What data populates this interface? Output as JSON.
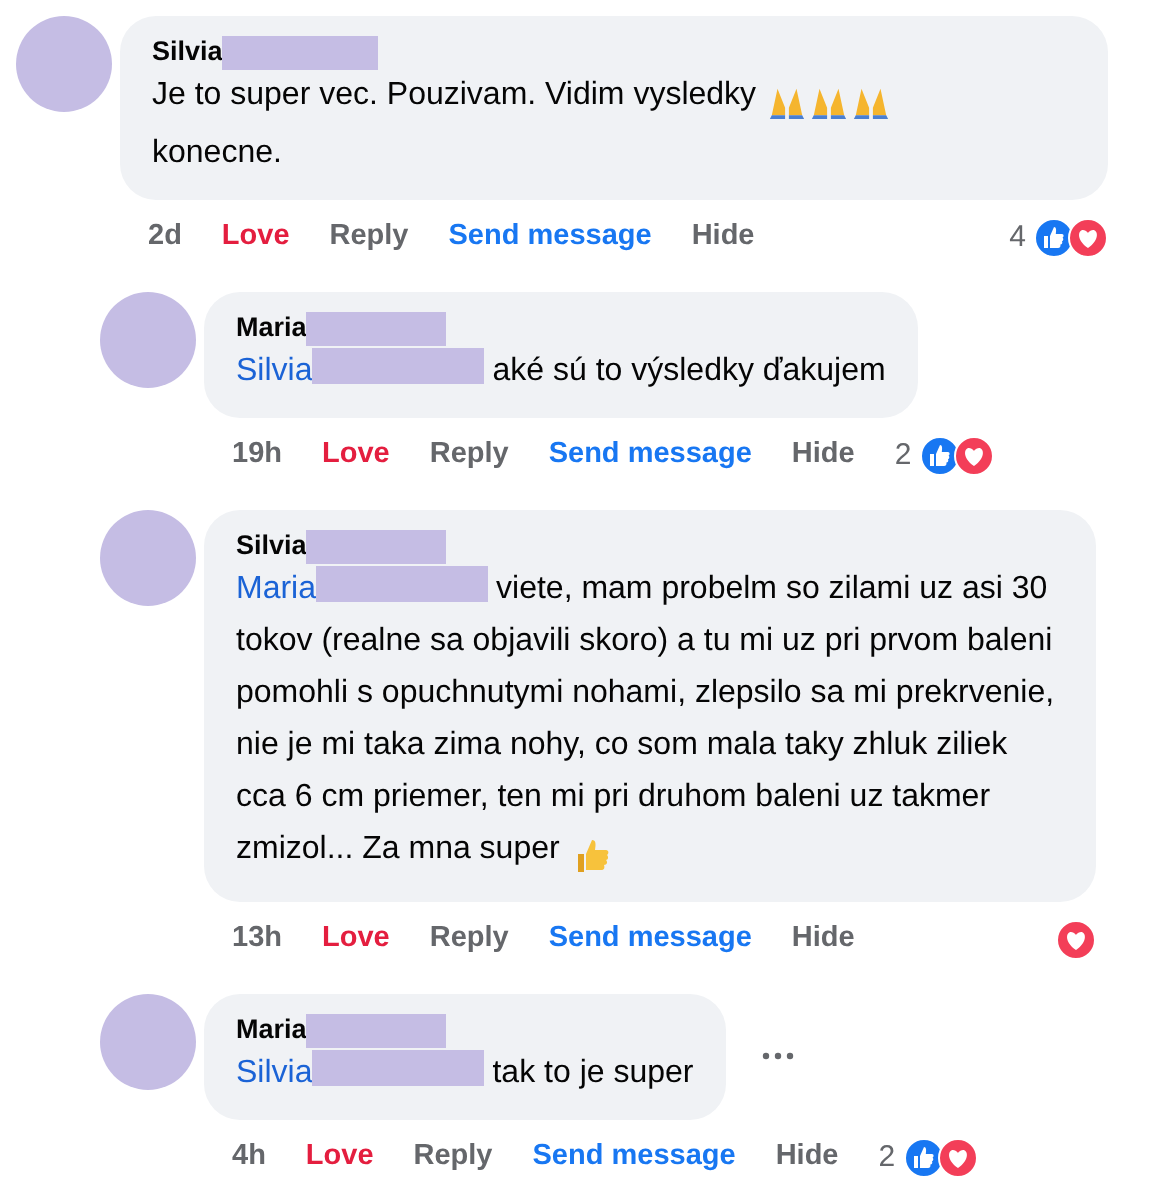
{
  "comments": [
    {
      "author": "Silvia",
      "text": "Je to super vec. Pouzivam. Vidim vysledky",
      "emoji": [
        {
          "kind": "pray"
        },
        {
          "kind": "pray"
        },
        {
          "kind": "pray"
        }
      ],
      "text_after": "konecne.",
      "time": "2d",
      "actions": [
        {
          "label": "Love",
          "kind": "react",
          "selected": true
        },
        {
          "label": "Reply",
          "kind": "plain"
        },
        {
          "label": "Send message",
          "kind": "link"
        },
        {
          "label": "Hide",
          "kind": "plain"
        }
      ],
      "reaction_count": "4",
      "reactions": [
        {
          "kind": "like"
        },
        {
          "kind": "love"
        }
      ],
      "children": [
        {
          "author": "Maria",
          "mention": "Silvia",
          "text": "aké sú to výsledky ďakujem",
          "time": "19h",
          "actions": [
            {
              "label": "Love",
              "kind": "react",
              "selected": true
            },
            {
              "label": "Reply",
              "kind": "plain"
            },
            {
              "label": "Send message",
              "kind": "link"
            },
            {
              "label": "Hide",
              "kind": "plain"
            }
          ],
          "reaction_count": "2",
          "reactions": [
            {
              "kind": "like"
            },
            {
              "kind": "love"
            }
          ]
        },
        {
          "author": "Silvia",
          "mention": "Maria",
          "text": "viete, mam probelm so zilami uz asi 30 tokov (realne sa objavili skoro) a tu mi uz pri prvom baleni pomohli s opuchnutymi nohami, zlepsilo sa mi prekrvenie, nie je mi taka zima nohy, co som mala taky zhluk ziliek cca 6 cm priemer, ten mi pri druhom baleni uz takmer zmizol... Za mna super",
          "emoji": [
            {
              "kind": "thumbs"
            }
          ],
          "time": "13h",
          "actions": [
            {
              "label": "Love",
              "kind": "react",
              "selected": true
            },
            {
              "label": "Reply",
              "kind": "plain"
            },
            {
              "label": "Send message",
              "kind": "link"
            },
            {
              "label": "Hide",
              "kind": "plain"
            }
          ],
          "reactions": [
            {
              "kind": "love"
            }
          ]
        },
        {
          "author": "Maria",
          "mention": "Silvia",
          "text": "tak to je super",
          "time": "4h",
          "actions": [
            {
              "label": "Love",
              "kind": "react",
              "selected": true
            },
            {
              "label": "Reply",
              "kind": "plain"
            },
            {
              "label": "Send message",
              "kind": "link"
            },
            {
              "label": "Hide",
              "kind": "plain"
            }
          ],
          "reaction_count": "2",
          "reactions": [
            {
              "kind": "like"
            },
            {
              "kind": "love"
            }
          ],
          "more_menu": true
        }
      ]
    }
  ]
}
